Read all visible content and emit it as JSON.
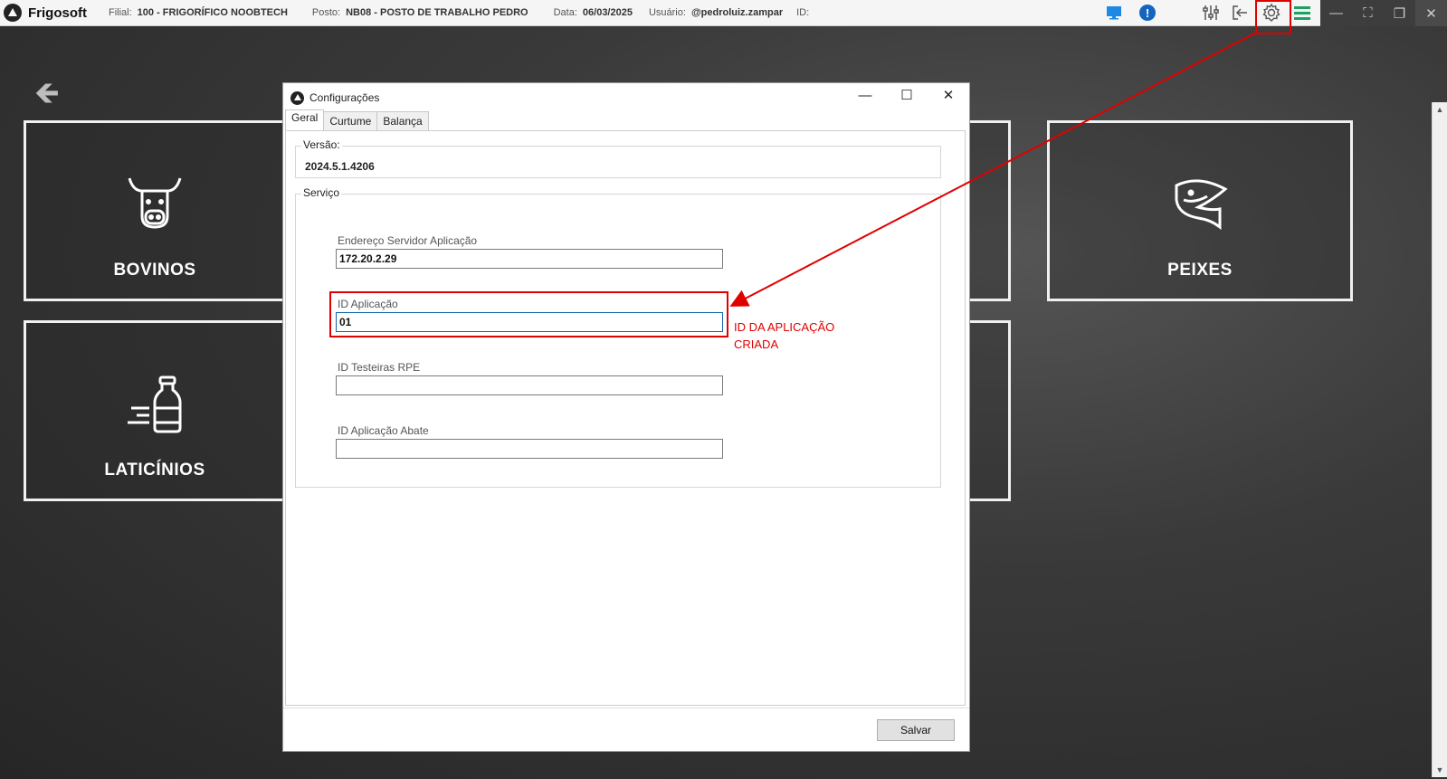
{
  "app": {
    "name": "Frigosoft",
    "filial_label": "Filial:",
    "filial_value": "100 - FRIGORÍFICO NOOBTECH",
    "posto_label": "Posto:",
    "posto_value": "NB08 - POSTO DE TRABALHO PEDRO",
    "data_label": "Data:",
    "data_value": "06/03/2025",
    "usuario_label": "Usuário:",
    "usuario_value": "@pedroluiz.zampar",
    "id_label": "ID:"
  },
  "toolbar_icons": [
    "monitor-icon",
    "alert-icon",
    "sliders-icon",
    "exit-icon",
    "gear-icon",
    "menu-icon"
  ],
  "window_controls": [
    "minimize",
    "restore",
    "maximize",
    "close"
  ],
  "tiles": [
    {
      "label": "BOVINOS",
      "icon": "cow-icon"
    },
    {
      "label": "LATICÍNIOS",
      "icon": "milk-bottle-icon"
    },
    {
      "label": "PEIXES",
      "icon": "fish-icon"
    }
  ],
  "dialog": {
    "title": "Configurações",
    "tabs": [
      "Geral",
      "Curtume",
      "Balança"
    ],
    "active_tab": "Geral",
    "versao": {
      "label": "Versão:",
      "value": "2024.5.1.4206"
    },
    "servico": {
      "label": "Serviço",
      "fields": [
        {
          "label": "Endereço Servidor Aplicação",
          "value": "172.20.2.29"
        },
        {
          "label": "ID Aplicação",
          "value": "01"
        },
        {
          "label": "ID Testeiras RPE",
          "value": ""
        },
        {
          "label": "ID Aplicação Abate",
          "value": ""
        }
      ]
    },
    "save_label": "Salvar"
  },
  "annotation": {
    "text": "ID DA APLICAÇÃO CRIADA",
    "color": "#e00000"
  }
}
